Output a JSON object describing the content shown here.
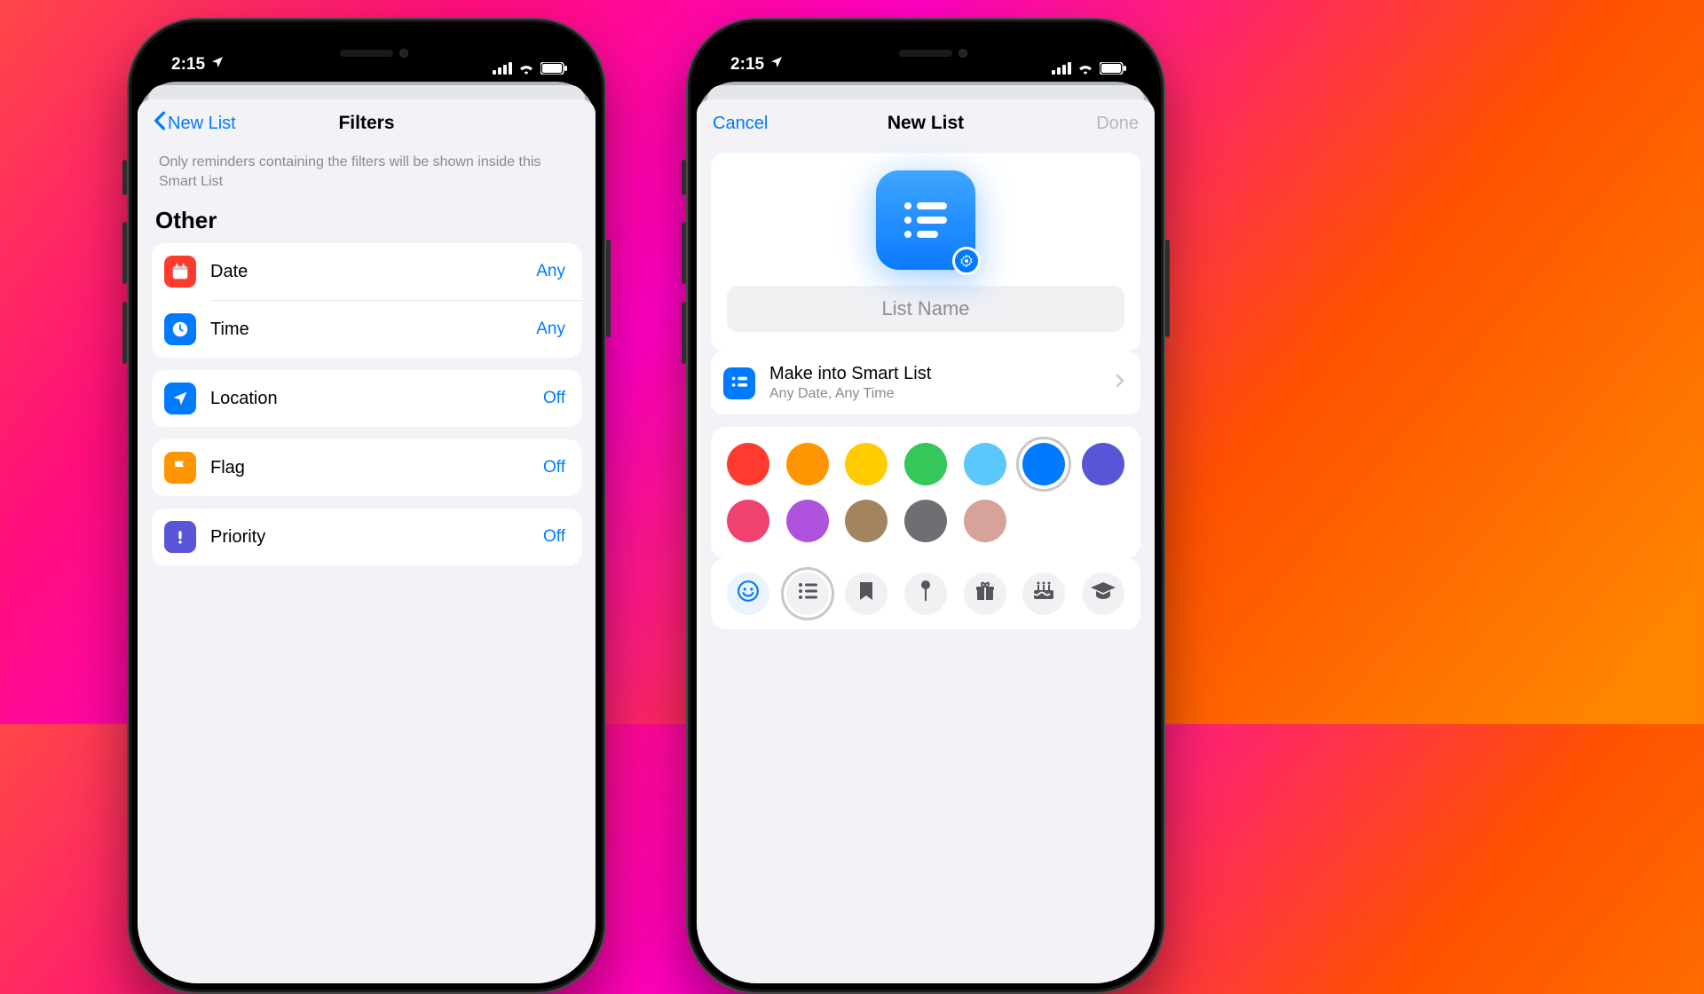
{
  "status": {
    "time": "2:15"
  },
  "left": {
    "nav": {
      "back": "New List",
      "title": "Filters"
    },
    "hint": "Only reminders containing the filters will be shown inside this Smart List",
    "section": "Other",
    "rows": {
      "date": {
        "label": "Date",
        "value": "Any"
      },
      "time": {
        "label": "Time",
        "value": "Any"
      },
      "location": {
        "label": "Location",
        "value": "Off"
      },
      "flag": {
        "label": "Flag",
        "value": "Off"
      },
      "priority": {
        "label": "Priority",
        "value": "Off"
      }
    }
  },
  "right": {
    "nav": {
      "cancel": "Cancel",
      "title": "New List",
      "done": "Done"
    },
    "listNamePlaceholder": "List Name",
    "smart": {
      "title": "Make into Smart List",
      "subtitle": "Any Date, Any Time"
    },
    "colors": [
      {
        "name": "red",
        "hex": "#ff3b30"
      },
      {
        "name": "orange",
        "hex": "#ff9500"
      },
      {
        "name": "yellow",
        "hex": "#ffcc00"
      },
      {
        "name": "green",
        "hex": "#34c759"
      },
      {
        "name": "lightblue",
        "hex": "#5ac8fa"
      },
      {
        "name": "blue",
        "hex": "#007aff",
        "selected": true
      },
      {
        "name": "indigo",
        "hex": "#5856d6"
      },
      {
        "name": "pink",
        "hex": "#ef426f"
      },
      {
        "name": "purple",
        "hex": "#af52de"
      },
      {
        "name": "brown",
        "hex": "#a2845e"
      },
      {
        "name": "gray",
        "hex": "#6e6e73"
      },
      {
        "name": "rose",
        "hex": "#d6a29a"
      }
    ],
    "iconPicks": [
      "emoji",
      "list",
      "bookmark",
      "pin",
      "gift",
      "cake",
      "graduation"
    ]
  }
}
